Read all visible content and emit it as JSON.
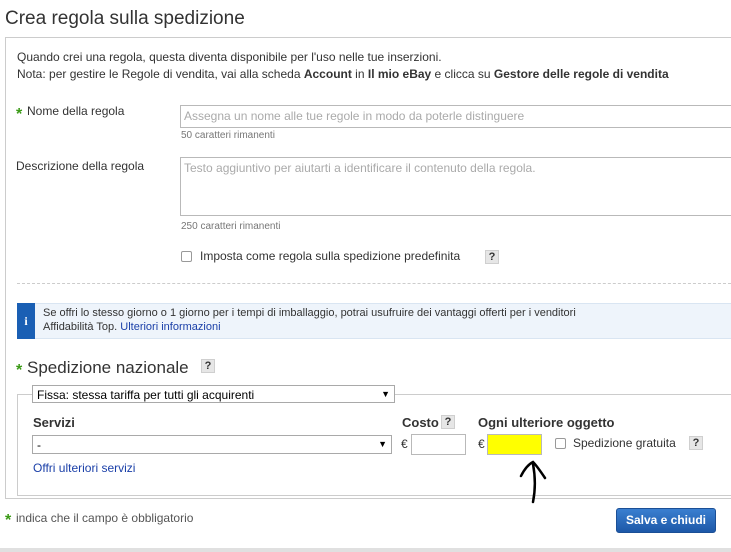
{
  "page_title": "Crea regola sulla spedizione",
  "intro": {
    "line1": "Quando crei una regola, questa diventa disponibile per l'uso nelle tue inserzioni.",
    "line2_prefix": "Nota: per gestire le Regole di vendita, vai alla scheda ",
    "line2_account": "Account",
    "line2_mid1": " in ",
    "line2_myebay": "Il mio eBay",
    "line2_mid2": " e clicca su ",
    "line2_manager": "Gestore delle regole di vendita"
  },
  "required_mark": "*",
  "name_field": {
    "label": "Nome della regola",
    "placeholder": "Assegna un nome alle tue regole in modo da poterle distinguere",
    "hint": "50 caratteri rimanenti"
  },
  "description_field": {
    "label": "Descrizione della regola",
    "placeholder": "Testo aggiuntivo per aiutarti a identificare il contenuto della regola.",
    "hint": "250 caratteri rimanenti"
  },
  "default_checkbox": {
    "label": "Imposta come regola sulla spedizione predefinita",
    "checked": false
  },
  "help_glyph": "?",
  "info": {
    "icon": "i",
    "line1": "Se offri lo stesso giorno o 1 giorno per i tempi di imballaggio, potrai usufruire dei vantaggi offerti per i venditori",
    "line2": "Affidabilità Top. ",
    "link": "Ulteriori informazioni"
  },
  "domestic": {
    "title": "Spedizione nazionale",
    "type_select": "Fissa: stessa tariffa per tutti gli acquirenti",
    "services_header": "Servizi",
    "cost_header": "Costo",
    "additional_header": "Ogni ulteriore oggetto",
    "service_select": "-",
    "currency": "€",
    "free_shipping_label": "Spedizione gratuita",
    "more_services_link": "Offri ulteriori servizi"
  },
  "footer": {
    "required_note": "indica che il campo è obbligatorio",
    "save_button": "Salva e chiudi"
  },
  "colors": {
    "accent_green": "#3a9a16",
    "link_blue": "#1a3fa8",
    "button_blue": "#1d58a8",
    "highlight_yellow": "#ffff00"
  }
}
